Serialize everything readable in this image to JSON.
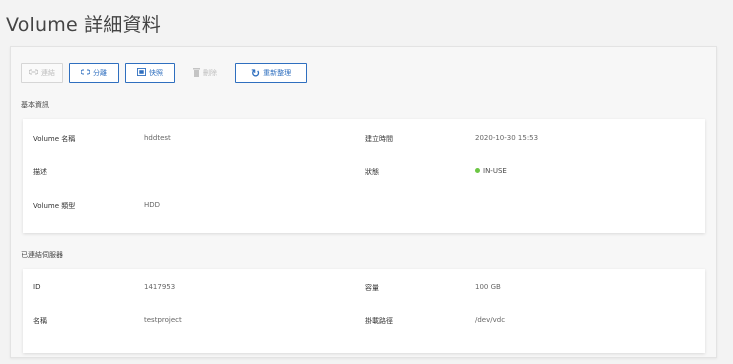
{
  "page": {
    "title": "Volume 詳細資料"
  },
  "toolbar": {
    "connect": {
      "label": "連結",
      "icon": "link-icon",
      "disabled": true
    },
    "detach": {
      "label": "分離",
      "icon": "unlink-icon",
      "disabled": false
    },
    "snapshot": {
      "label": "快照",
      "icon": "snapshot-icon",
      "disabled": false
    },
    "delete": {
      "label": "刪除",
      "icon": "trash-icon",
      "disabled": true
    },
    "refresh": {
      "label": "重新整理",
      "icon": "refresh-icon",
      "disabled": false
    }
  },
  "basic_info": {
    "section_title": "基本資訊",
    "volume_name_label": "Volume 名稱",
    "volume_name_value": "hddtest",
    "created_label": "建立時間",
    "created_value": "2020-10-30 15:53",
    "description_label": "描述",
    "description_value": "",
    "status_label": "狀態",
    "status_value": "IN-USE",
    "status_color": "#6cc644",
    "volume_type_label": "Volume 類型",
    "volume_type_value": "HDD"
  },
  "attached": {
    "section_title": "已連結伺服器",
    "id_label": "ID",
    "id_value": "1417953",
    "capacity_label": "容量",
    "capacity_value": "100 GB",
    "name_label": "名稱",
    "name_value": "testproject",
    "mount_path_label": "掛載路徑",
    "mount_path_value": "/dev/vdc"
  },
  "colors": {
    "accent": "#2f6fbf",
    "disabled": "#bdbdbd"
  }
}
